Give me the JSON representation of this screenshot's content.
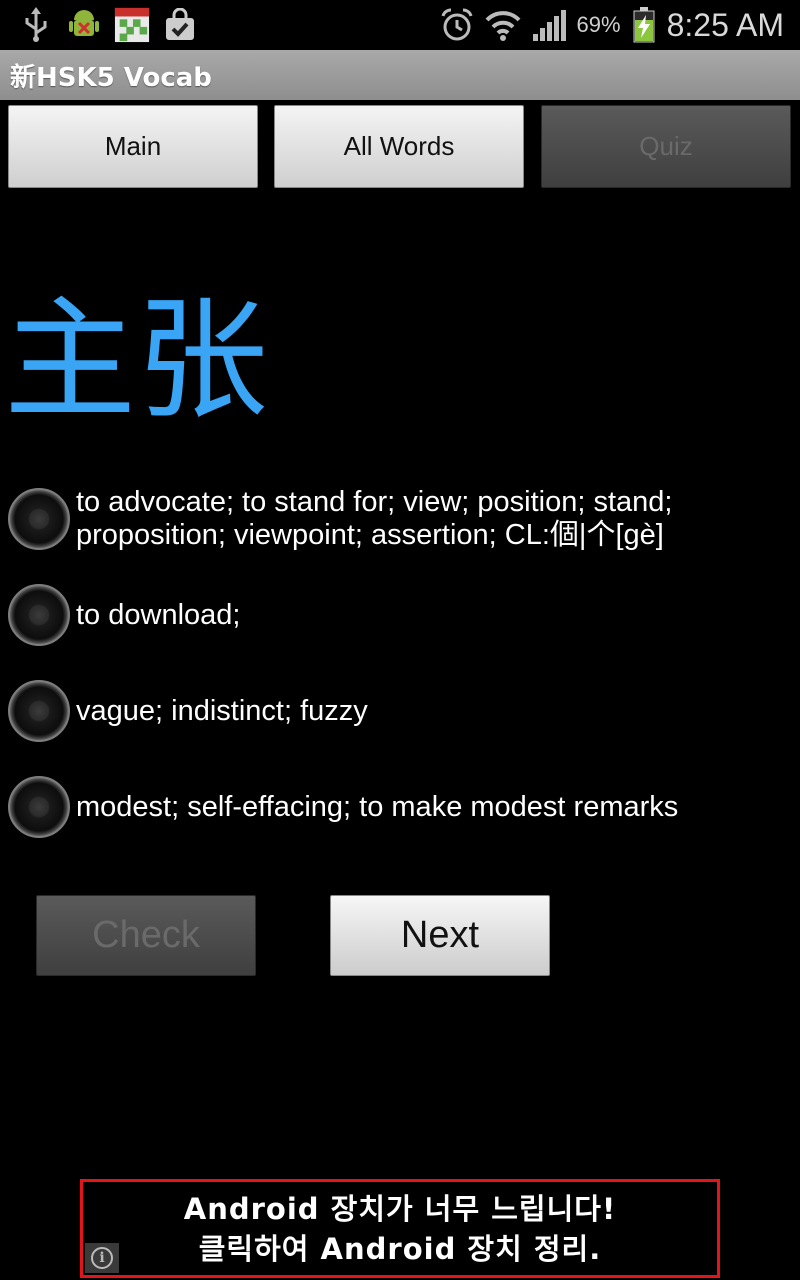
{
  "status_bar": {
    "left_icons": [
      "usb-icon",
      "android-debug-icon",
      "calendar-icon",
      "shopping-bag-icon"
    ],
    "right_icons": [
      "alarm-icon",
      "wifi-icon",
      "signal-icon"
    ],
    "battery_percent": "69%",
    "battery_level": 0.69,
    "battery_charging": true,
    "time": "8:25 AM"
  },
  "app": {
    "title": "新HSK5 Vocab"
  },
  "tabs": [
    {
      "label": "Main",
      "enabled": true
    },
    {
      "label": "All Words",
      "enabled": true
    },
    {
      "label": "Quiz",
      "enabled": false
    }
  ],
  "quiz": {
    "word": "主张",
    "options": [
      {
        "text": "to advocate; to stand for; view; position; stand; proposition; viewpoint; assertion; CL:個|个[gè]",
        "selected": false
      },
      {
        "text": "to download;",
        "selected": false
      },
      {
        "text": "vague; indistinct; fuzzy",
        "selected": false
      },
      {
        "text": "modest; self-effacing; to make modest remarks",
        "selected": false
      }
    ],
    "check_label": "Check",
    "check_enabled": false,
    "next_label": "Next"
  },
  "ad": {
    "line1": "Android 장치가 너무 느립니다!",
    "line2": "클릭하여 Android 장치 정리.",
    "info_icon": "info-icon",
    "border_color": "#e4141c"
  },
  "colors": {
    "word": "#39a5f4",
    "background": "#000000"
  }
}
